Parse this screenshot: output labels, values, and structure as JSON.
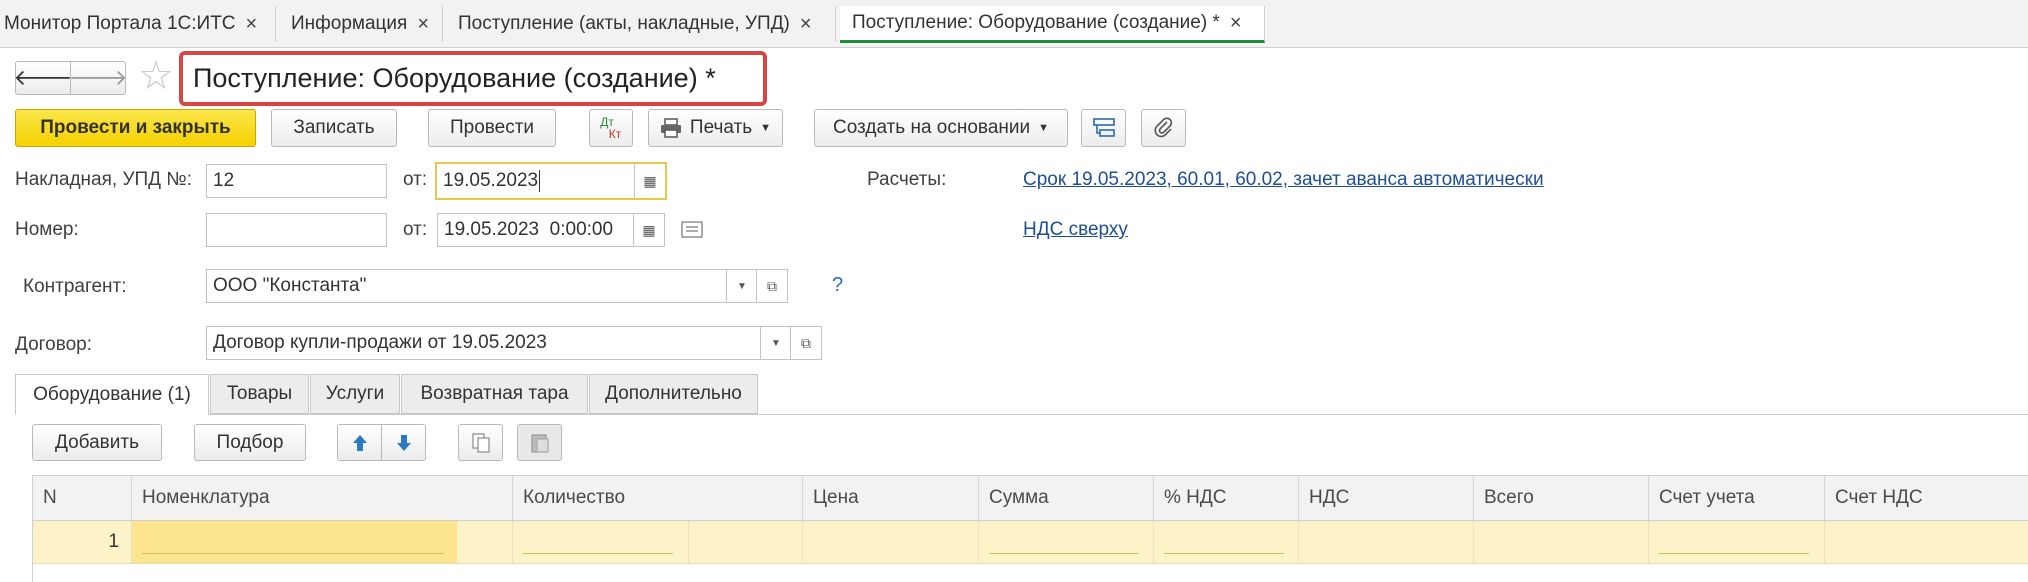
{
  "tabs": [
    {
      "label": "Монитор Портала 1С:ИТС",
      "close": "×"
    },
    {
      "label": "Информация",
      "close": "×"
    },
    {
      "label": "Поступление (акты, накладные, УПД)",
      "close": "×"
    },
    {
      "label": "Поступление: Оборудование (создание) *",
      "close": "×"
    }
  ],
  "nav": {
    "back": "🡐",
    "forward": "🡒",
    "star": "☆"
  },
  "title": "Поступление: Оборудование (создание) *",
  "toolbar": {
    "post_close": "Провести и закрыть",
    "save": "Записать",
    "post": "Провести",
    "dtkt_top": "Дт",
    "dtkt_bottom": "Кт",
    "print": "Печать",
    "create_based": "Создать на основании"
  },
  "form": {
    "invoice_label": "Накладная, УПД №:",
    "invoice_value": "12",
    "from_label": "от:",
    "invoice_date": "19.05.2023",
    "number_label": "Номер:",
    "number_value": "",
    "number_date": "19.05.2023  0:00:00",
    "settlements_label": "Расчеты:",
    "settlements_link": "Срок 19.05.2023, 60.01, 60.02, зачет аванса автоматически",
    "vat_link": "НДС сверху",
    "counterparty_label": "Контрагент:",
    "counterparty_value": "ООО \"Константа\"",
    "help": "?",
    "contract_label": "Договор:",
    "contract_value": "Договор купли-продажи от 19.05.2023"
  },
  "inner_tabs": [
    "Оборудование (1)",
    "Товары",
    "Услуги",
    "Возвратная тара",
    "Дополнительно"
  ],
  "table_toolbar": {
    "add": "Добавить",
    "pick": "Подбор"
  },
  "table": {
    "columns": [
      "N",
      "Номенклатура",
      "Количество",
      "Цена",
      "Сумма",
      "% НДС",
      "НДС",
      "Всего",
      "Счет учета",
      "Счет НДС"
    ],
    "rows": [
      {
        "n": "1"
      }
    ]
  }
}
